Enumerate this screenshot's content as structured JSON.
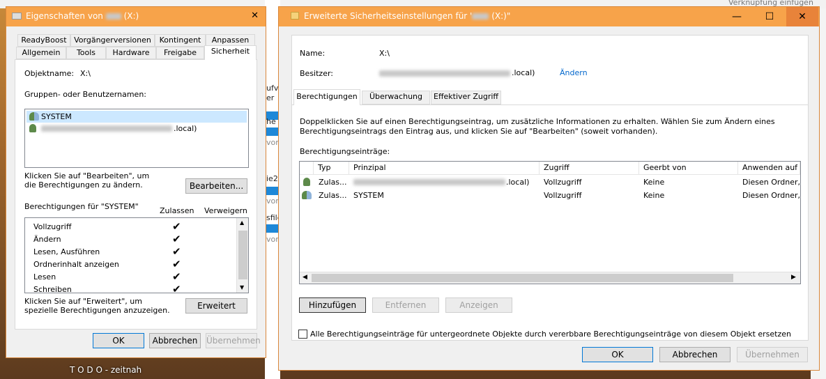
{
  "background": {
    "taskbar_label": "T O D O - zeitnah",
    "behind_top_right": "Verknüpfung einfügen",
    "behind_strip": [
      "ufv",
      "er",
      "he (",
      "vor",
      "ie2\\",
      "vor",
      "sfile",
      "vor"
    ]
  },
  "props": {
    "title_prefix": "Eigenschaften von",
    "title_suffix": "(X:)",
    "close_glyph": "✕",
    "tabs_row1": [
      "ReadyBoost",
      "Vorgängerversionen",
      "Kontingent",
      "Anpassen"
    ],
    "tabs_row2": [
      "Allgemein",
      "Tools",
      "Hardware",
      "Freigabe",
      "Sicherheit"
    ],
    "object_label": "Objektname:",
    "object_value": "X:\\",
    "groups_label": "Gruppen- oder Benutzernamen:",
    "users": [
      {
        "name": "SYSTEM",
        "icon": "group-users-icon"
      },
      {
        "name": ".local)",
        "icon": "user-icon"
      }
    ],
    "edit_hint": "Klicken Sie auf \"Bearbeiten\", um die Berechtigungen zu ändern.",
    "edit_button": "Bearbeiten...",
    "perm_for": "Berechtigungen für \"SYSTEM\"",
    "col_allow": "Zulassen",
    "col_deny": "Verweigern",
    "permissions": [
      "Vollzugriff",
      "Ändern",
      "Lesen, Ausführen",
      "Ordnerinhalt anzeigen",
      "Lesen",
      "Schreiben"
    ],
    "check_glyph": "✔",
    "advanced_hint": "Klicken Sie auf \"Erweitert\", um spezielle Berechtigungen anzuzeigen.",
    "advanced_button": "Erweitert",
    "ok": "OK",
    "cancel": "Abbrechen",
    "apply": "Übernehmen"
  },
  "adv": {
    "title_prefix": "Erweiterte Sicherheitseinstellungen für '",
    "title_suffix": "(X:)\"",
    "min_glyph": "—",
    "max_glyph": "☐",
    "close_glyph": "✕",
    "name_label": "Name:",
    "name_value": "X:\\",
    "owner_label": "Besitzer:",
    "owner_value_suffix": ".local)",
    "owner_change": "Ändern",
    "tabs": [
      "Berechtigungen",
      "Überwachung",
      "Effektiver Zugriff"
    ],
    "info": "Doppelklicken Sie auf einen Berechtigungseintrag, um zusätzliche Informationen zu erhalten. Wählen Sie zum Ändern eines Berechtigungseintrags den Eintrag aus, und klicken Sie auf \"Bearbeiten\" (soweit vorhanden).",
    "entries_label": "Berechtigungseinträge:",
    "columns": [
      "Typ",
      "Prinzipal",
      "Zugriff",
      "Geerbt von",
      "Anwenden auf"
    ],
    "rows": [
      {
        "type": "Zulas...",
        "principal": ".local)",
        "access": "Vollzugriff",
        "inherited": "Keine",
        "applies": "Diesen Ordner, U",
        "icon": "user-icon"
      },
      {
        "type": "Zulas...",
        "principal": "SYSTEM",
        "access": "Vollzugriff",
        "inherited": "Keine",
        "applies": "Diesen Ordner, U",
        "icon": "group-users-icon"
      }
    ],
    "add_button": "Hinzufügen",
    "remove_button": "Entfernen",
    "view_button": "Anzeigen",
    "replace_checkbox": "Alle Berechtigungseinträge für untergeordnete Objekte durch vererbbare Berechtigungseinträge von diesem Objekt ersetzen",
    "ok": "OK",
    "cancel": "Abbrechen",
    "apply": "Übernehmen"
  }
}
